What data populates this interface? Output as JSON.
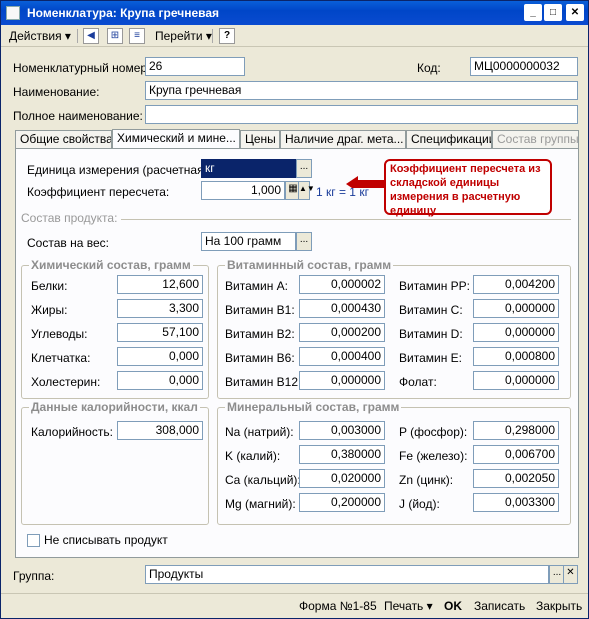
{
  "window": {
    "title": "Номенклатура: Крупа гречневая"
  },
  "toolbar": {
    "actions_label": "Действия",
    "goto_label": "Перейти",
    "help_label": "?"
  },
  "header": {
    "nom_number_label": "Номенклатурный номер:",
    "nom_number_value": "26",
    "code_label": "Код:",
    "code_value": "МЦ0000000032",
    "name_label": "Наименование:",
    "name_value": "Крупа гречневая",
    "fullname_label": "Полное наименование:",
    "fullname_value": ""
  },
  "tabs": [
    {
      "label": "Общие свойства"
    },
    {
      "label": "Химический и мине..."
    },
    {
      "label": "Цены"
    },
    {
      "label": "Наличие драг. мета..."
    },
    {
      "label": "Спецификации"
    },
    {
      "label": "Состав группы"
    }
  ],
  "main": {
    "unit_label": "Единица измерения (расчетная):",
    "unit_value": "кг",
    "coef_label": "Коэффициент пересчета:",
    "coef_value": "1,000",
    "coef_note": "1 кг = 1 кг",
    "callout_text": "Коэффициент пересчета из складской единицы измерения в расчетную единицу",
    "composition_label": "Состав продукта:",
    "weight_label": "Состав на вес:",
    "weight_value": "На 100 грамм"
  },
  "chemical": {
    "title": "Химический состав, грамм",
    "items": [
      {
        "label": "Белки:",
        "value": "12,600"
      },
      {
        "label": "Жиры:",
        "value": "3,300"
      },
      {
        "label": "Углеводы:",
        "value": "57,100"
      },
      {
        "label": "Клетчатка:",
        "value": "0,000"
      },
      {
        "label": "Холестерин:",
        "value": "0,000"
      }
    ]
  },
  "vitamins": {
    "title": "Витаминный состав, грамм",
    "left": [
      {
        "label": "Витамин A:",
        "value": "0,000002"
      },
      {
        "label": "Витамин B1:",
        "value": "0,000430"
      },
      {
        "label": "Витамин B2:",
        "value": "0,000200"
      },
      {
        "label": "Витамин B6:",
        "value": "0,000400"
      },
      {
        "label": "Витамин B12:",
        "value": "0,000000"
      }
    ],
    "right": [
      {
        "label": "Витамин PP:",
        "value": "0,004200"
      },
      {
        "label": "Витамин C:",
        "value": "0,000000"
      },
      {
        "label": "Витамин D:",
        "value": "0,000000"
      },
      {
        "label": "Витамин E:",
        "value": "0,000800"
      },
      {
        "label": "Фолат:",
        "value": "0,000000"
      }
    ]
  },
  "calories": {
    "title": "Данные калорийности, ккал",
    "label": "Калорийность:",
    "value": "308,000"
  },
  "minerals": {
    "title": "Минеральный состав, грамм",
    "left": [
      {
        "label": "Na (натрий):",
        "value": "0,003000"
      },
      {
        "label": "K (калий):",
        "value": "0,380000"
      },
      {
        "label": "Ca (кальций):",
        "value": "0,020000"
      },
      {
        "label": "Mg (магний):",
        "value": "0,200000"
      }
    ],
    "right": [
      {
        "label": "P (фосфор):",
        "value": "0,298000"
      },
      {
        "label": "Fe (железо):",
        "value": "0,006700"
      },
      {
        "label": "Zn (цинк):",
        "value": "0,002050"
      },
      {
        "label": "J (йод):",
        "value": "0,003300"
      }
    ]
  },
  "no_writeoff_label": "Не списывать продукт",
  "group": {
    "label": "Группа:",
    "value": "Продукты"
  },
  "bottom": {
    "form_label": "Форма №1-85",
    "print_label": "Печать",
    "ok_label": "OK",
    "save_label": "Записать",
    "close_label": "Закрыть"
  },
  "colors": {
    "title_bar": "#0a5fd9",
    "callout": "#c00000",
    "note": "#1a3c9a"
  }
}
